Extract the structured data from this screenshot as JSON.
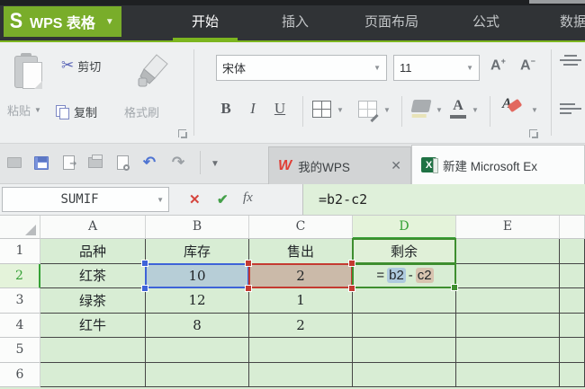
{
  "title_bar": {
    "logo_s": "S",
    "logo_text": "WPS 表格",
    "tabs": [
      {
        "label": "开始",
        "active": true
      },
      {
        "label": "插入",
        "active": false
      },
      {
        "label": "页面布局",
        "active": false
      },
      {
        "label": "公式",
        "active": false
      },
      {
        "label": "数据",
        "active": false
      }
    ]
  },
  "ribbon": {
    "paste_label": "粘贴",
    "cut_label": "剪切",
    "copy_label": "复制",
    "format_painter_label": "格式刷",
    "font_name": "宋体",
    "font_size": "11",
    "bold_label": "B",
    "italic_label": "I",
    "underline_label": "U",
    "grow_font_label": "A",
    "shrink_font_label": "A"
  },
  "doc_tabs": [
    {
      "label": "我的WPS",
      "close": "✕",
      "active": false
    },
    {
      "label": "新建 Microsoft Ex",
      "active": true
    }
  ],
  "formula_bar": {
    "name_box": "SUMIF",
    "cancel": "✕",
    "enter": "✔",
    "insert_function": "fx",
    "formula": "=b2-c2"
  },
  "sheet": {
    "col_headers": [
      "A",
      "B",
      "C",
      "D",
      "E"
    ],
    "active_col": "D",
    "active_row": "2",
    "row_numbers": [
      "1",
      "2",
      "3",
      "4",
      "5",
      "6"
    ],
    "rows": [
      [
        "品种",
        "库存",
        "售出",
        "剩余",
        ""
      ],
      [
        "红茶",
        "10",
        "2",
        "",
        ""
      ],
      [
        "绿茶",
        "12",
        "1",
        "",
        ""
      ],
      [
        "红牛",
        "8",
        "2",
        "",
        ""
      ],
      [
        "",
        "",
        "",
        "",
        ""
      ],
      [
        "",
        "",
        "",
        "",
        ""
      ]
    ],
    "selections": {
      "blue_cell": "B2",
      "red_cell": "C2",
      "edit_cell": "D2",
      "edit_segments": [
        {
          "text": "=",
          "hl": ""
        },
        {
          "text": "b2",
          "hl": "blue"
        },
        {
          "text": "-",
          "hl": ""
        },
        {
          "text": "c2",
          "hl": "tan"
        }
      ]
    }
  },
  "colors": {
    "brand_green": "#7cb51f",
    "titlebar": "#303336",
    "sheet_bg": "#d8edd4",
    "blue_selection": "#3e63d8",
    "red_selection": "#c43a31",
    "green_selection": "#3e8e2f",
    "formula_input_bg": "#dff0da"
  }
}
